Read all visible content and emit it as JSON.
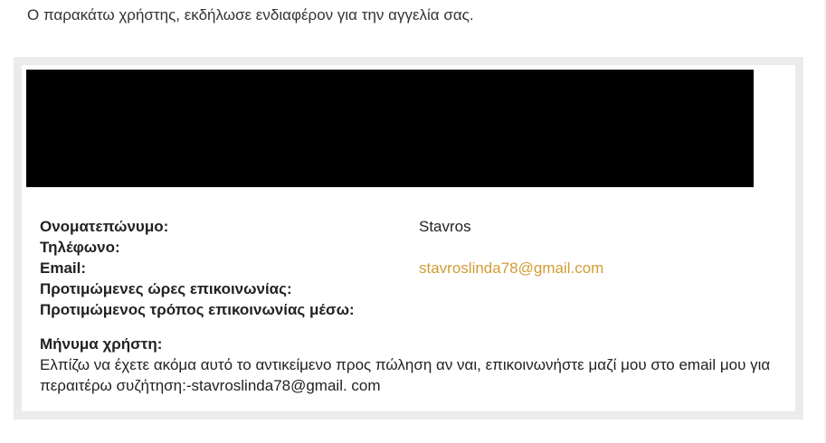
{
  "intro_text": "Ο παρακάτω χρήστης, εκδήλωσε ενδιαφέρον για την αγγελία σας.",
  "fields": [
    {
      "label": "Ονοματεπώνυμο:",
      "value": "Stavros"
    },
    {
      "label": "Τηλέφωνο:",
      "value": ""
    },
    {
      "label": "Email:",
      "value": "stavroslinda78@gmail.com"
    },
    {
      "label": "Προτιμώμενες ώρες επικοινωνίας:",
      "value": ""
    },
    {
      "label": "Προτιμώμενος τρόπος επικοινωνίας μέσω:",
      "value": ""
    }
  ],
  "message": {
    "label": "Μήνυμα χρήστη:",
    "body": "Ελπίζω να έχετε ακόμα αυτό το αντικείμενο προς πώληση αν ναι, επικοινωνήστε μαζί μου στο email μου για περαιτέρω συζήτηση:-stavroslinda78@gmail. com"
  },
  "colors": {
    "link": "#d29c34",
    "card_border": "#ebebeb",
    "banner": "#000000"
  }
}
